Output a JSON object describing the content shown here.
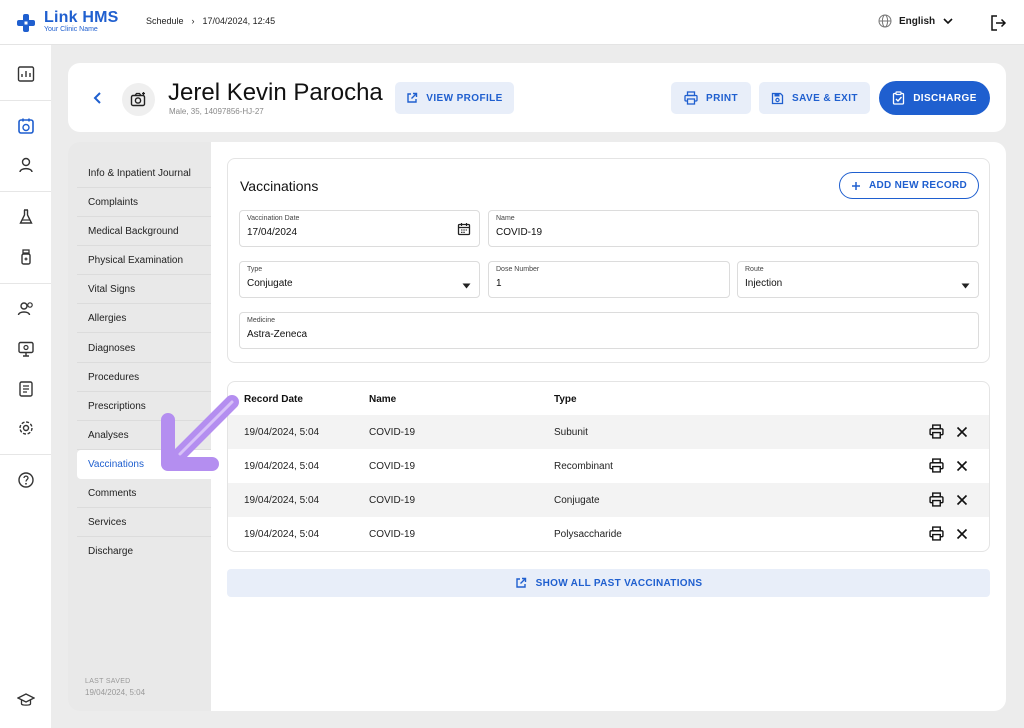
{
  "app": {
    "name": "Link HMS",
    "subtitle": "Your Clinic Name"
  },
  "breadcrumb": {
    "items": [
      "Schedule",
      "17/04/2024, 12:45"
    ],
    "separator": "›"
  },
  "language": {
    "selected": "English"
  },
  "patient": {
    "name": "Jerel Kevin Parocha",
    "meta": "Male, 35, 14097856-HJ-27"
  },
  "header": {
    "view_profile": "VIEW PROFILE",
    "print": "PRINT",
    "save_exit": "SAVE & EXIT",
    "discharge": "DISCHARGE"
  },
  "sidebar": {
    "items": [
      "Info & Inpatient Journal",
      "Complaints",
      "Medical Background",
      "Physical Examination",
      "Vital Signs",
      "Allergies",
      "Diagnoses",
      "Procedures",
      "Prescriptions",
      "Analyses",
      "Vaccinations",
      "Comments",
      "Services",
      "Discharge"
    ],
    "active": "Vaccinations",
    "last_saved_label": "LAST SAVED",
    "last_saved_value": "19/04/2024, 5:04"
  },
  "vaccinations": {
    "title": "Vaccinations",
    "add_button": "ADD NEW RECORD",
    "fields": {
      "date": {
        "label": "Vaccination Date",
        "value": "17/04/2024"
      },
      "name": {
        "label": "Name",
        "value": "COVID-19"
      },
      "type": {
        "label": "Type",
        "value": "Conjugate"
      },
      "dose": {
        "label": "Dose Number",
        "value": "1"
      },
      "route": {
        "label": "Route",
        "value": "Injection"
      },
      "medicine": {
        "label": "Medicine",
        "value": "Astra-Zeneca"
      }
    }
  },
  "records": {
    "headers": [
      "Record Date",
      "Name",
      "Type"
    ],
    "rows": [
      {
        "date": "19/04/2024, 5:04",
        "name": "COVID-19",
        "type": "Subunit"
      },
      {
        "date": "19/04/2024, 5:04",
        "name": "COVID-19",
        "type": "Recombinant"
      },
      {
        "date": "19/04/2024, 5:04",
        "name": "COVID-19",
        "type": "Conjugate"
      },
      {
        "date": "19/04/2024, 5:04",
        "name": "COVID-19",
        "type": "Polysaccharide"
      }
    ]
  },
  "show_all": "SHOW ALL PAST VACCINATIONS",
  "colors": {
    "accent": "#1f5fcf",
    "annotation": "#b48ef0"
  }
}
